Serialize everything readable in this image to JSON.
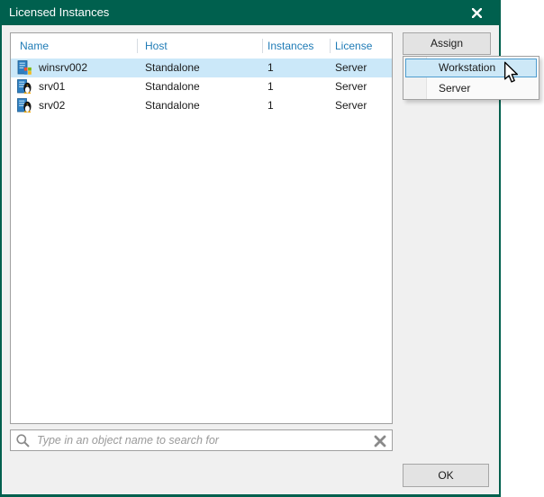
{
  "window": {
    "title": "Licensed Instances"
  },
  "toolbar": {
    "assign_label": "Assign"
  },
  "table": {
    "columns": [
      "Name",
      "Host",
      "Instances",
      "License"
    ],
    "rows": [
      {
        "icon": "windows-server-icon",
        "name": "winsrv002",
        "host": "Standalone",
        "instances": "1",
        "license": "Server",
        "selected": true
      },
      {
        "icon": "linux-server-icon",
        "name": "srv01",
        "host": "Standalone",
        "instances": "1",
        "license": "Server",
        "selected": false
      },
      {
        "icon": "linux-server-icon",
        "name": "srv02",
        "host": "Standalone",
        "instances": "1",
        "license": "Server",
        "selected": false
      }
    ]
  },
  "assign_menu": {
    "items": [
      {
        "label": "Workstation",
        "highlighted": true
      },
      {
        "label": "Server",
        "highlighted": false
      }
    ]
  },
  "search": {
    "value": "",
    "placeholder": "Type in an object name to search for"
  },
  "footer": {
    "ok_label": "OK"
  },
  "colors": {
    "titlebar": "#00604e",
    "dialog_background": "#f0f0f0",
    "header_text": "#1f7bb6",
    "row_selection": "#cbe8f9",
    "menu_highlight": "#cde8f7",
    "menu_highlight_border": "#4e9dcf"
  }
}
